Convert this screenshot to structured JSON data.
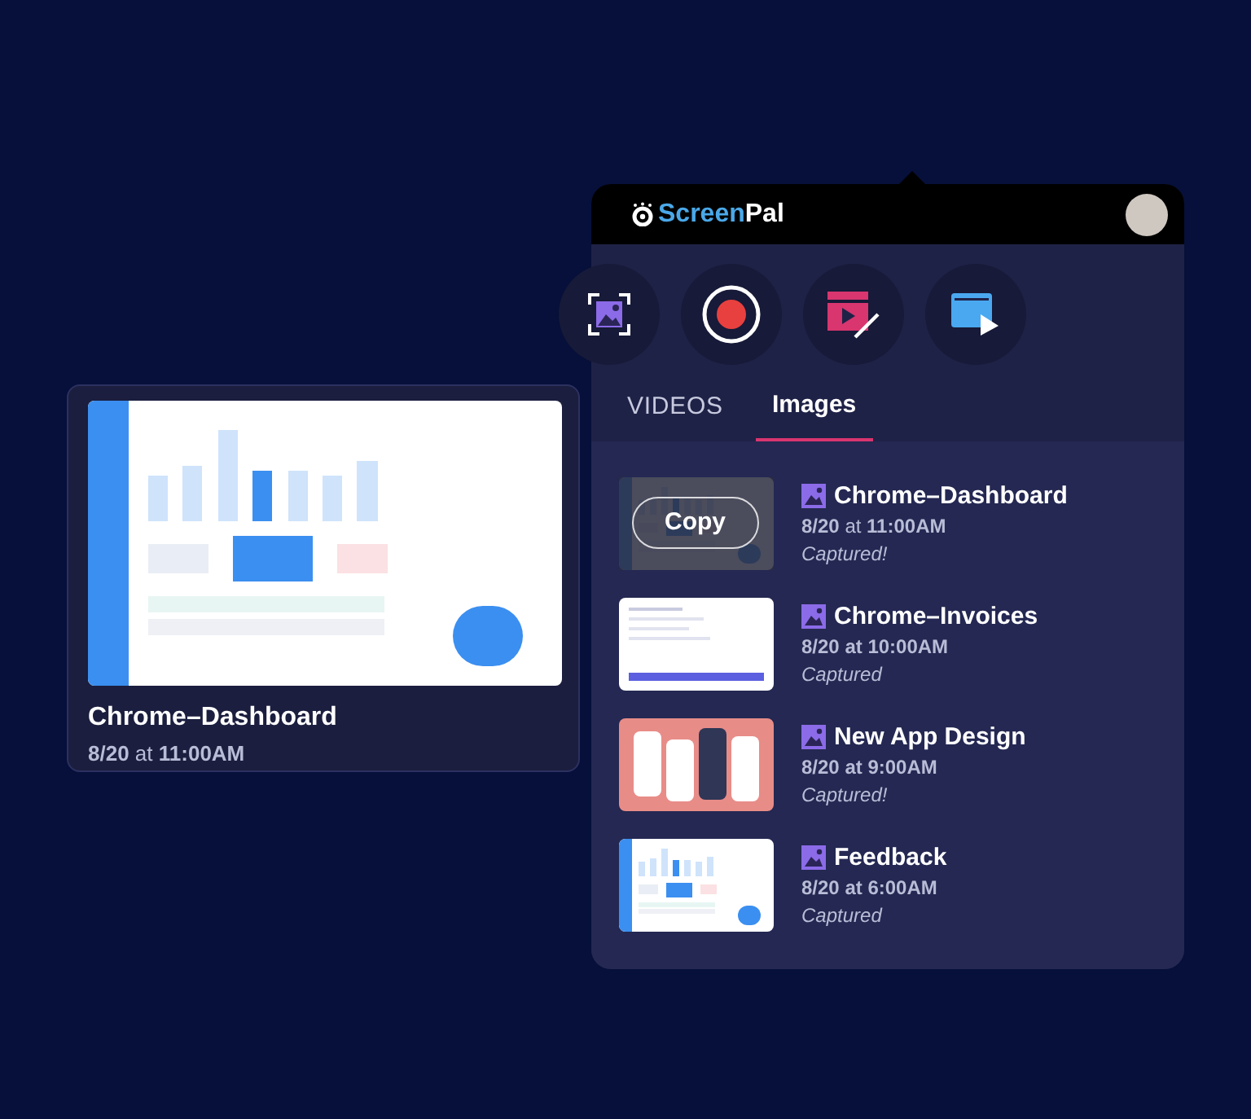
{
  "preview": {
    "title": "Chrome–Dashboard",
    "date": "**8/20** at **11:00AM**",
    "thumbnail": {
      "kind": "dashboard"
    }
  },
  "panel": {
    "brand": {
      "prefix": "Screen",
      "suffix": "Pal"
    },
    "tools": [
      {
        "kind": "screenshot"
      },
      {
        "kind": "record"
      },
      {
        "kind": "editor"
      },
      {
        "kind": "player"
      }
    ],
    "tabs": [
      {
        "label": "VIDEOS",
        "selected": false
      },
      {
        "label": "Images",
        "selected": true
      }
    ],
    "items": [
      {
        "title": "Chrome–Dashboard",
        "date": "**8/20** at **11:00AM**",
        "status": "Captured!",
        "thumbnail": {
          "kind": "dashboard"
        },
        "copy_button": "Copy"
      },
      {
        "title": "Chrome–Invoices",
        "date": "**8/20 at 10:00AM**",
        "status": "Captured",
        "thumbnail": {
          "kind": "invoices"
        }
      },
      {
        "title": "New App Design",
        "date": "**8/20 at 9:00AM**",
        "status": "Captured!",
        "thumbnail": {
          "kind": "app"
        }
      },
      {
        "title": "Feedback",
        "date": "**8/20 at 6:00AM**",
        "status": "Captured",
        "thumbnail": {
          "kind": "dashboard"
        }
      }
    ]
  }
}
